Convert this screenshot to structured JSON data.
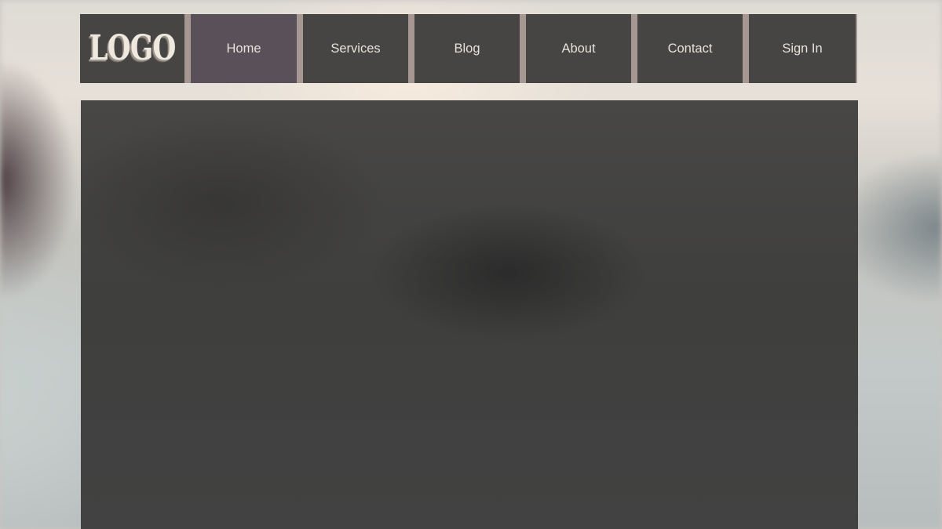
{
  "logo": {
    "text": "LOGO"
  },
  "nav": {
    "items": [
      {
        "label": "Home",
        "active": true
      },
      {
        "label": "Services",
        "active": false
      },
      {
        "label": "Blog",
        "active": false
      },
      {
        "label": "About",
        "active": false
      },
      {
        "label": "Contact",
        "active": false
      },
      {
        "label": "Sign In",
        "active": false
      }
    ]
  },
  "colors": {
    "nav_background": "#464544",
    "nav_active": "#59505a",
    "nav_text": "#e7e1d9",
    "separator": "#a69793",
    "content_panel": "#434342"
  }
}
